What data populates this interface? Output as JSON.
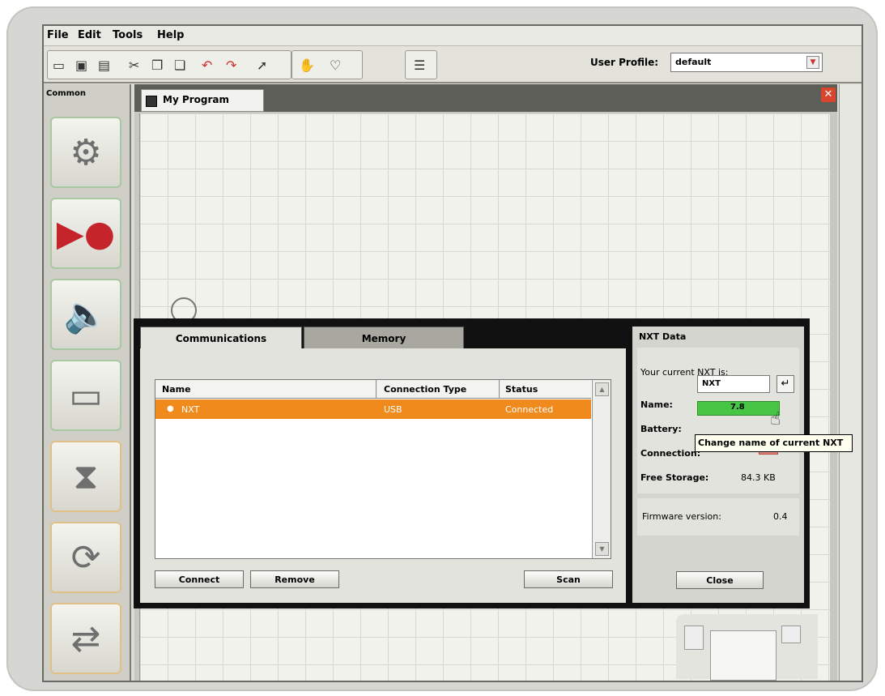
{
  "menu": {
    "file": "File",
    "edit": "Edit",
    "tools": "Tools",
    "help": "Help"
  },
  "toolbar": {
    "profile_label": "User Profile:",
    "profile_value": "default"
  },
  "palette": {
    "title": "Common"
  },
  "program": {
    "tab_title": "My Program"
  },
  "dialog": {
    "tabs": [
      "Communications",
      "Memory"
    ],
    "table": {
      "headers": [
        "Name",
        "Connection Type",
        "Status"
      ],
      "rows": [
        {
          "name": "NXT",
          "type": "USB",
          "status": "Connected"
        }
      ]
    },
    "buttons": {
      "connect": "Connect",
      "remove": "Remove",
      "scan": "Scan",
      "close": "Close"
    },
    "nxt": {
      "title": "NXT Data",
      "current": "Your current NXT is:",
      "name_label": "Name:",
      "name_value": "NXT",
      "battery_label": "Battery:",
      "battery_value": "7.8",
      "connection_label": "Connection:",
      "storage_label": "Free Storage:",
      "storage_value": "84.3 KB",
      "firmware_label": "Firmware version:",
      "firmware_value": "0.4"
    }
  },
  "tooltip": "Change name of current NXT"
}
